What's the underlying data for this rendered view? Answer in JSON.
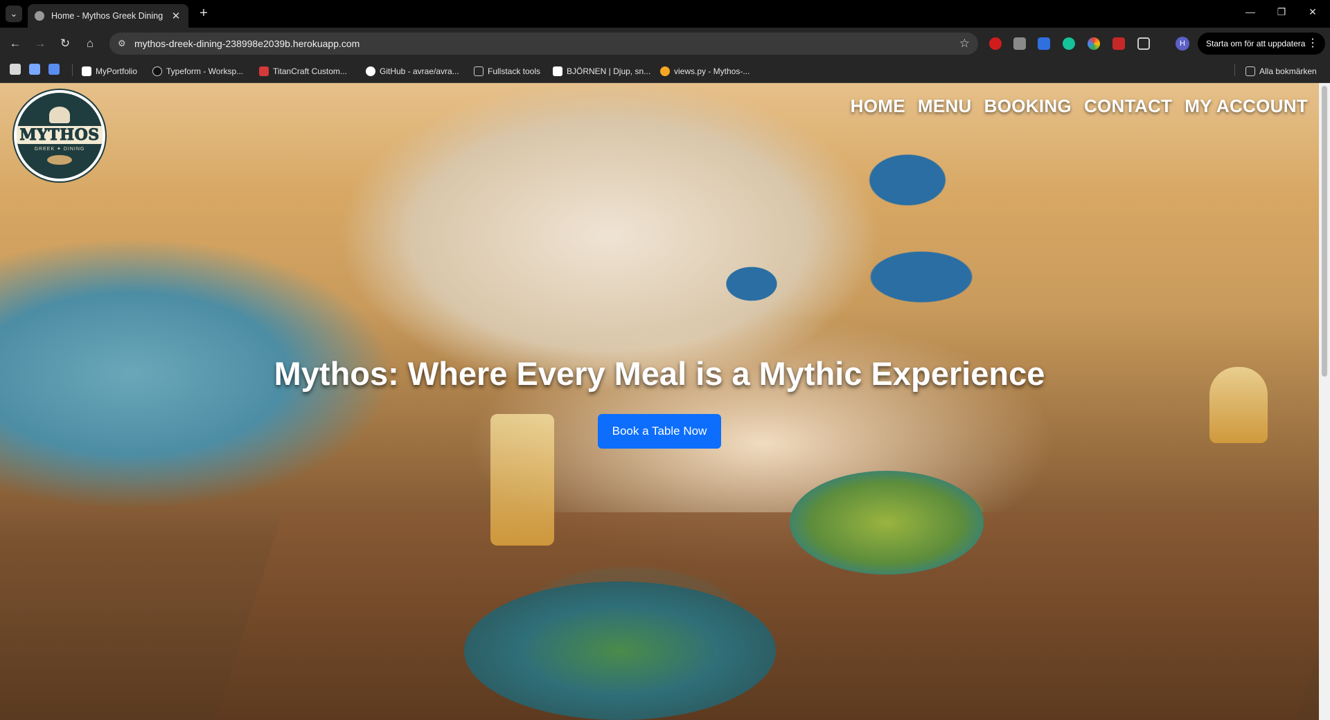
{
  "browser": {
    "tab_title": "Home - Mythos Greek Dining",
    "url": "mythos-dreek-dining-238998e2039b.herokuapp.com",
    "profile_initial": "H",
    "update_label": "Starta om för att uppdatera",
    "bookmarks": [
      {
        "label": "MyPortfolio",
        "color": "#ffffff"
      },
      {
        "label": "Typeform - Worksp...",
        "color": "#111111"
      },
      {
        "label": "TitanCraft Custom...",
        "color": "#d4393b"
      },
      {
        "label": "GitHub - avrae/avra...",
        "color": "#ffffff"
      },
      {
        "label": "Fullstack tools",
        "color": "#888888"
      },
      {
        "label": "BJÖRNEN | Djup, sn...",
        "color": "#ffffff"
      },
      {
        "label": "views.py - Mythos-...",
        "color": "#f5a623"
      }
    ],
    "all_bookmarks_label": "Alla bokmärken"
  },
  "site": {
    "logo_text": "MYTHOS",
    "logo_sub": "GREEK ✦ DINING",
    "nav": [
      "HOME",
      "MENU",
      "BOOKING",
      "CONTACT",
      "MY ACCOUNT"
    ],
    "headline": "Mythos: Where Every Meal is a Mythic Experience",
    "cta_label": "Book a Table Now",
    "accent_color": "#0d6efd"
  }
}
